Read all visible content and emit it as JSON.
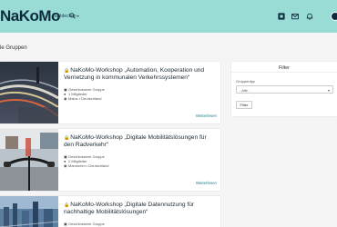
{
  "header": {
    "logo": "NaKoMo",
    "explore": "Entdecken",
    "explore_chevron": "▾",
    "icons": [
      "search-icon",
      "dashboard-icon",
      "mail-icon",
      "bell-icon",
      "user-avatar"
    ]
  },
  "page": {
    "title": "le Gruppen"
  },
  "cards": [
    {
      "title": "NaKoMo-Workshop „Automation, Kooperation und Vernetzung in kommunalen Verkehrssystemen“",
      "type": "Geschlossene Gruppe",
      "members": "1 Mitglieder",
      "location": "Mainz • Deutschland",
      "more": "Weiterlesen"
    },
    {
      "title": "NaKoMo-Workshop „Digitale Mobilitätslösungen für den Radverkehr“",
      "type": "Geschlossene Gruppe",
      "members": "2 Mitglieder",
      "location": "Mannheim • Deutschland",
      "more": "Weiterlesen"
    },
    {
      "title": "NaKoMo-Workshop „Digitale Datennutzung für nachhaltige Mobilitätslösungen“",
      "type": "Geschlossene Gruppe",
      "members": "",
      "location": "",
      "more": ""
    }
  ],
  "filter": {
    "title": "Filter",
    "group_type_label": "Gruppentyp",
    "group_type_value": "- Alle -",
    "apply_button": "Filter"
  },
  "colors": {
    "header_bg": "#99dcd6",
    "logo": "#0d2b3e",
    "link": "#1f7f8c"
  }
}
